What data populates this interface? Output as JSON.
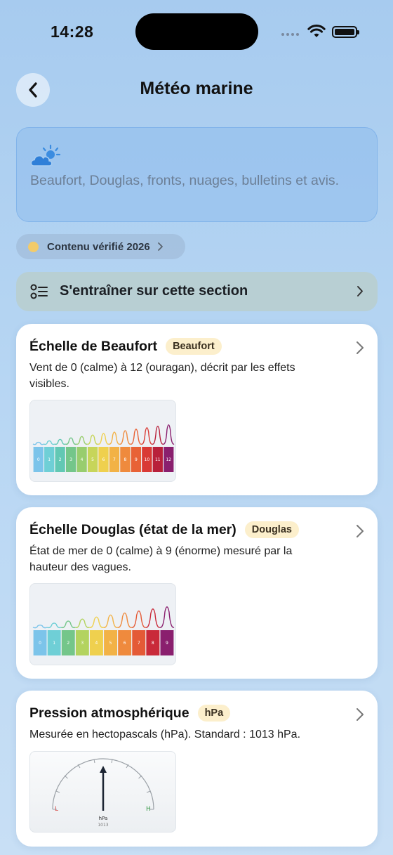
{
  "status": {
    "time": "14:28"
  },
  "nav": {
    "title": "Météo marine"
  },
  "intro": {
    "icon": "partly-cloudy-icon",
    "description": "Beaufort, Douglas, fronts, nuages, bulletins et avis."
  },
  "verified": {
    "label": "Contenu vérifié 2026"
  },
  "train": {
    "label": "S'entraîner sur cette section"
  },
  "cards": [
    {
      "title": "Échelle de Beaufort",
      "badge": "Beaufort",
      "description": "Vent de 0 (calme) à 12 (ouragan), décrit par les effets visibles.",
      "scale_labels": [
        "0",
        "1",
        "2",
        "3",
        "4",
        "5",
        "6",
        "7",
        "8",
        "9",
        "10",
        "11",
        "12"
      ],
      "scale_colors": [
        "#7cc4ea",
        "#6fcfd6",
        "#62c8b4",
        "#74c68a",
        "#98cd6e",
        "#c7d55a",
        "#efd04e",
        "#f2b246",
        "#ef8a3d",
        "#e86236",
        "#d93a35",
        "#b8203a",
        "#8a1f6e"
      ]
    },
    {
      "title": "Échelle Douglas (état de la mer)",
      "badge": "Douglas",
      "description": "État de mer de 0 (calme) à 9 (énorme) mesuré par la hauteur des vagues.",
      "scale_labels": [
        "0",
        "1",
        "2",
        "3",
        "4",
        "5",
        "6",
        "7",
        "8",
        "9"
      ],
      "scale_colors": [
        "#7cc4ea",
        "#6fcfd6",
        "#74c68a",
        "#b3d35f",
        "#efd04e",
        "#f2b246",
        "#ef8a3d",
        "#e45a36",
        "#c92a3a",
        "#8a1f6e"
      ]
    },
    {
      "title": "Pression atmosphérique",
      "badge": "hPa",
      "description": "Mesurée en hectopascals (hPa). Standard : 1013 hPa.",
      "gauge": {
        "unit": "hPa",
        "value": "1013",
        "low": "L",
        "high": "H"
      }
    }
  ]
}
